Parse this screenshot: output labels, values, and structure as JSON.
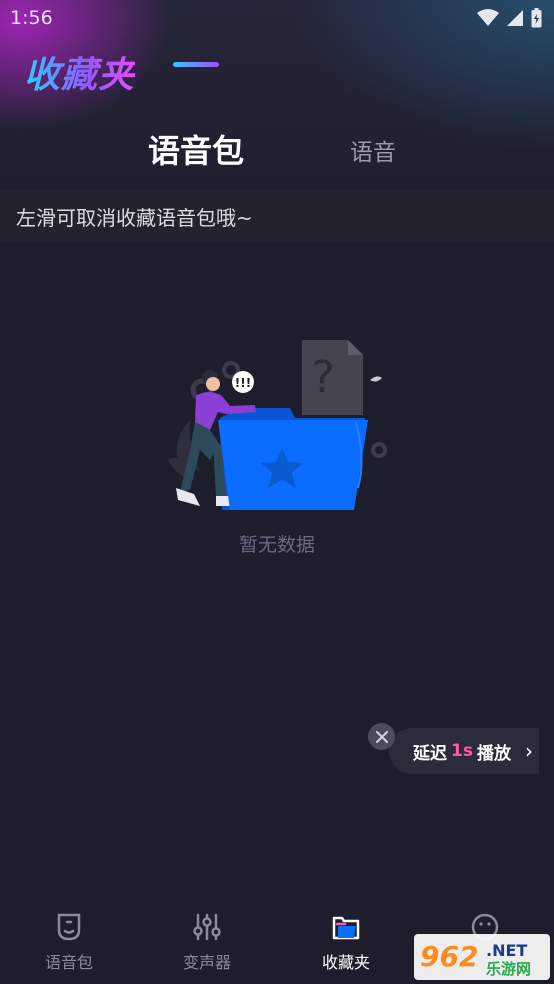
{
  "status": {
    "time": "1:56"
  },
  "app_title": "收藏夹",
  "tabs": [
    {
      "label": "语音包",
      "active": true
    },
    {
      "label": "语音",
      "active": false
    }
  ],
  "hint": "左滑可取消收藏语音包哦~",
  "empty_state": {
    "text": "暂无数据",
    "speech_bubble": "!!!"
  },
  "delay_popup": {
    "prefix": "延迟",
    "value": "1s",
    "suffix": "播放",
    "chevron": "›"
  },
  "bottom_nav": [
    {
      "label": "语音包",
      "icon": "badge-icon",
      "active": false
    },
    {
      "label": "变声器",
      "icon": "sliders-icon",
      "active": false
    },
    {
      "label": "收藏夹",
      "icon": "folder-icon",
      "active": true
    },
    {
      "label": "",
      "icon": "smiley-icon",
      "active": false
    }
  ],
  "watermark": {
    "text_a": "962",
    "text_b": ".NET",
    "text_c": "乐游网"
  },
  "colors": {
    "background": "#1d1d2b",
    "accent_blue": "#0a6dff",
    "accent_pink": "#ff5aa0",
    "title_gradient_start": "#2bd3ff",
    "title_gradient_end": "#e24dff"
  }
}
